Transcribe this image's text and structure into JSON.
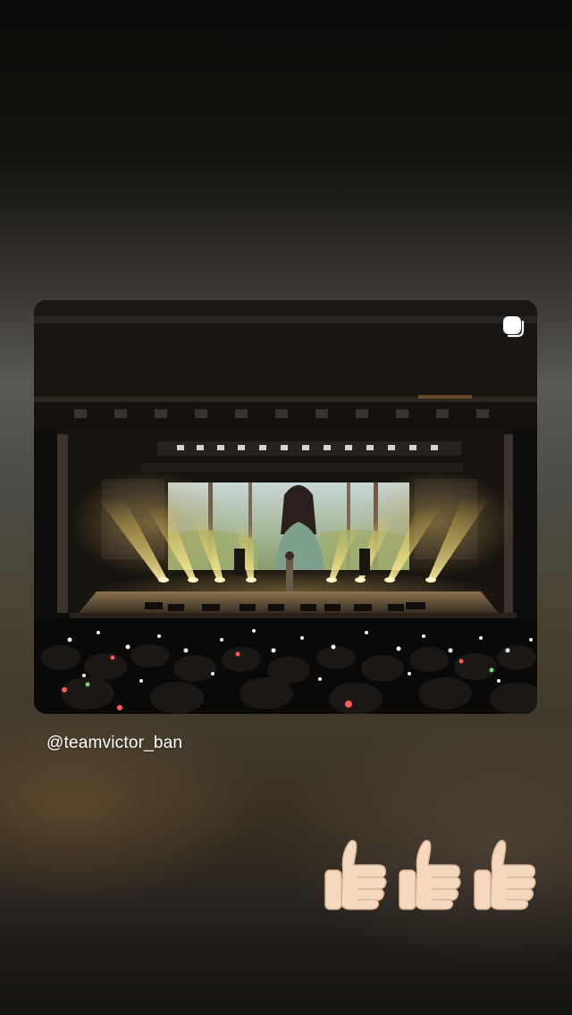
{
  "story": {
    "mention": "@teamvictor_ban",
    "photo": {
      "subject": "concert-stage-photo",
      "sticker_icon": "reshare-sticker-icon"
    },
    "reaction": {
      "emoji": "thumbs-up-icon",
      "count": 3,
      "skin_color": "#f4d9c0"
    }
  }
}
